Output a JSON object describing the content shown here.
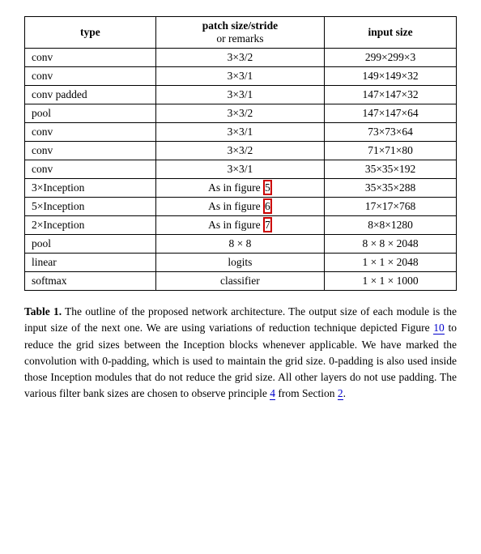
{
  "table": {
    "headers": [
      {
        "main": "type",
        "sub": ""
      },
      {
        "main": "patch size/stride",
        "sub": "or remarks"
      },
      {
        "main": "input size",
        "sub": ""
      }
    ],
    "rows": [
      {
        "type": "conv",
        "patch": "3×3/2",
        "input": "299×299×3"
      },
      {
        "type": "conv",
        "patch": "3×3/1",
        "input": "149×149×32"
      },
      {
        "type": "conv padded",
        "patch": "3×3/1",
        "input": "147×147×32"
      },
      {
        "type": "pool",
        "patch": "3×3/2",
        "input": "147×147×64"
      },
      {
        "type": "conv",
        "patch": "3×3/1",
        "input": "73×73×64"
      },
      {
        "type": "conv",
        "patch": "3×3/2",
        "input": "71×71×80"
      },
      {
        "type": "conv",
        "patch": "3×3/1",
        "input": "35×35×192"
      },
      {
        "type": "3×Inception",
        "patch": "As in figure 5",
        "input": "35×35×288",
        "highlight_patch": true
      },
      {
        "type": "5×Inception",
        "patch": "As in figure 6",
        "input": "17×17×768",
        "highlight_patch": true
      },
      {
        "type": "2×Inception",
        "patch": "As in figure 7",
        "input": "8×8×1280",
        "highlight_patch": true
      },
      {
        "type": "pool",
        "patch": "8 × 8",
        "input": "8 × 8 × 2048"
      },
      {
        "type": "linear",
        "patch": "logits",
        "input": "1 × 1 × 2048"
      },
      {
        "type": "softmax",
        "patch": "classifier",
        "input": "1 × 1 × 1000"
      }
    ]
  },
  "caption": {
    "title": "Table 1.",
    "text": " The outline of the proposed network architecture.  The output size of each module is the input size of the next one.  We are using variations of reduction technique depicted Figure ",
    "ref1": "10",
    "text2": " to reduce the grid sizes between the Inception blocks whenever applicable.  We have marked the convolution with 0-padding, which is used to maintain the grid size.  0-padding is also used inside those Inception modules that do not reduce the grid size.  All other layers do not use padding.  The various filter bank sizes are chosen to observe principle ",
    "ref2": "4",
    "text3": " from Section ",
    "ref3": "2",
    "text4": "."
  },
  "highlighted_rows": [
    7,
    8,
    9
  ]
}
